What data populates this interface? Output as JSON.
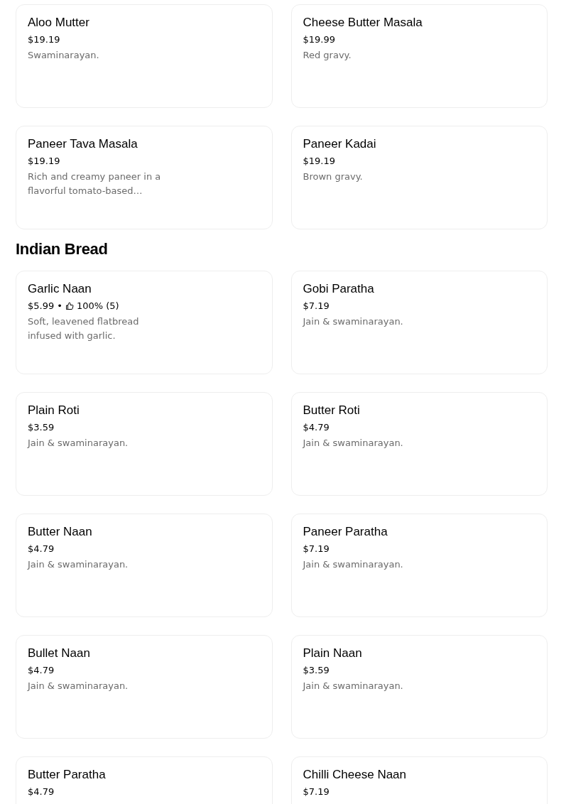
{
  "sections": [
    {
      "items": [
        {
          "name": "Aloo Mutter",
          "price": "$19.19",
          "description": "Swaminarayan."
        },
        {
          "name": "Cheese Butter Masala",
          "price": "$19.99",
          "description": "Red gravy."
        },
        {
          "name": "Paneer Tava Masala",
          "price": "$19.19",
          "description": "Rich and creamy paneer in a flavorful tomato-based…"
        },
        {
          "name": "Paneer Kadai",
          "price": "$19.19",
          "description": "Brown gravy."
        }
      ]
    },
    {
      "heading": "Indian Bread",
      "items": [
        {
          "name": "Garlic Naan",
          "price": "$5.99",
          "separator": "•",
          "rating": "100% (5)",
          "description": "Soft, leavened flatbread infused with garlic."
        },
        {
          "name": "Gobi Paratha",
          "price": "$7.19",
          "description": "Jain & swaminarayan."
        },
        {
          "name": "Plain Roti",
          "price": "$3.59",
          "description": "Jain & swaminarayan."
        },
        {
          "name": "Butter Roti",
          "price": "$4.79",
          "description": "Jain & swaminarayan."
        },
        {
          "name": "Butter Naan",
          "price": "$4.79",
          "description": "Jain & swaminarayan."
        },
        {
          "name": "Paneer Paratha",
          "price": "$7.19",
          "description": "Jain & swaminarayan."
        },
        {
          "name": "Bullet Naan",
          "price": "$4.79",
          "description": "Jain & swaminarayan."
        },
        {
          "name": "Plain Naan",
          "price": "$3.59",
          "description": "Jain & swaminarayan."
        },
        {
          "name": "Butter Paratha",
          "price": "$4.79"
        },
        {
          "name": "Chilli Cheese Naan",
          "price": "$7.19"
        }
      ]
    }
  ]
}
